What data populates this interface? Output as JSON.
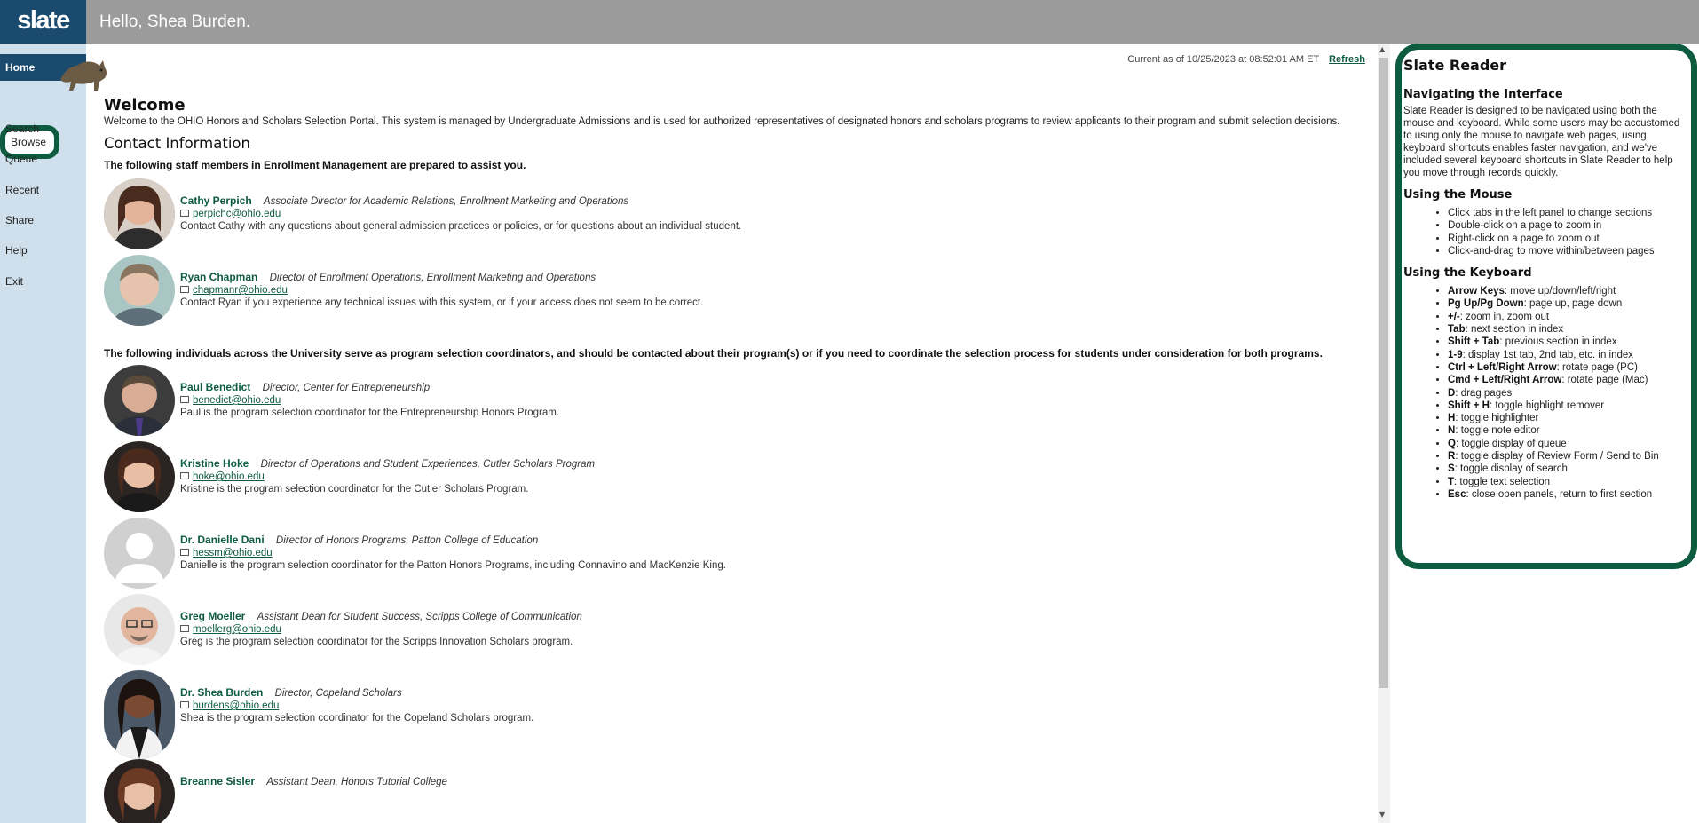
{
  "header": {
    "logo": "slate",
    "greeting": "Hello, Shea Burden."
  },
  "sidebar": {
    "items": [
      "Home",
      "Browse",
      "Search",
      "Queue",
      "Recent",
      "Share",
      "Help",
      "Exit"
    ]
  },
  "main": {
    "timestamp": "Current as of 10/25/2023 at 08:52:01 AM ET",
    "refresh": "Refresh",
    "welcome_title": "Welcome",
    "welcome_text": "Welcome to the OHIO Honors and Scholars Selection Portal. This system is managed by Undergraduate Admissions and is used for authorized representatives of designated honors and scholars programs to review applicants to their program and submit selection decisions.",
    "contact_title": "Contact Information",
    "staff_lead": "The following staff members in Enrollment Management are prepared to assist you.",
    "coord_lead": "The following individuals across the University serve as program selection coordinators, and should be contacted about their program(s) or if you need to coordinate the selection process for students under consideration for both programs.",
    "staff": [
      {
        "name": "Cathy Perpich",
        "title": "Associate Director for Academic Relations, Enrollment Marketing and Operations",
        "email": "perpichc@ohio.edu",
        "note": "Contact Cathy with any questions about general admission practices or policies, or for questions about an individual student."
      },
      {
        "name": "Ryan Chapman",
        "title": "Director of Enrollment Operations, Enrollment Marketing and Operations",
        "email": "chapmanr@ohio.edu",
        "note": "Contact Ryan if you experience any technical issues with this system, or if your access does not seem to be correct."
      }
    ],
    "coordinators": [
      {
        "name": "Paul Benedict",
        "title": "Director, Center for Entrepreneurship",
        "email": "benedict@ohio.edu",
        "note": "Paul is the program selection coordinator for the Entrepreneurship Honors Program."
      },
      {
        "name": "Kristine Hoke",
        "title": "Director of Operations and Student Experiences, Cutler Scholars Program",
        "email": "hoke@ohio.edu",
        "note": "Kristine is the program selection coordinator for the Cutler Scholars Program."
      },
      {
        "name": "Dr. Danielle Dani",
        "title": "Director of Honors Programs, Patton College of Education",
        "email": "hessm@ohio.edu",
        "note": "Danielle is the program selection coordinator for the Patton Honors Programs, including Connavino and MacKenzie King."
      },
      {
        "name": "Greg Moeller",
        "title": "Assistant Dean for Student Success, Scripps College of Communication",
        "email": "moellerg@ohio.edu",
        "note": "Greg is the program selection coordinator for the Scripps Innovation Scholars program."
      },
      {
        "name": "Dr. Shea Burden",
        "title": "Director, Copeland Scholars",
        "email": "burdens@ohio.edu",
        "note": "Shea is the program selection coordinator for the Copeland Scholars program."
      },
      {
        "name": "Breanne Sisler",
        "title": "Assistant Dean, Honors Tutorial College",
        "email": "",
        "note": ""
      }
    ]
  },
  "reader": {
    "title": "Slate Reader",
    "nav_title": "Navigating the Interface",
    "nav_text": "Slate Reader is designed to be navigated using both the mouse and keyboard. While some users may be accustomed to using only the mouse to navigate web pages, using keyboard shortcuts enables faster navigation, and we've included several keyboard shortcuts in Slate Reader to help you move through records quickly.",
    "mouse_title": "Using the Mouse",
    "mouse_items": [
      "Click tabs in the left panel to change sections",
      "Double-click on a page to zoom in",
      "Right-click on a page to zoom out",
      "Click-and-drag to move within/between pages"
    ],
    "keyboard_title": "Using the Keyboard",
    "keyboard_items": [
      {
        "key": "Arrow Keys",
        "desc": ": move up/down/left/right"
      },
      {
        "key": "Pg Up/Pg Down",
        "desc": ": page up, page down"
      },
      {
        "key": "+/-",
        "desc": ": zoom in, zoom out"
      },
      {
        "key": "Tab",
        "desc": ": next section in index"
      },
      {
        "key": "Shift + Tab",
        "desc": ": previous section in index"
      },
      {
        "key": "1-9",
        "desc": ": display 1st tab, 2nd tab, etc. in index"
      },
      {
        "key": "Ctrl + Left/Right Arrow",
        "desc": ": rotate page (PC)"
      },
      {
        "key": "Cmd + Left/Right Arrow",
        "desc": ": rotate page (Mac)"
      },
      {
        "key": "D",
        "desc": ": drag pages"
      },
      {
        "key": "Shift + H",
        "desc": ": toggle highlight remover"
      },
      {
        "key": "H",
        "desc": ": toggle highlighter"
      },
      {
        "key": "N",
        "desc": ": toggle note editor"
      },
      {
        "key": "Q",
        "desc": ": toggle display of queue"
      },
      {
        "key": "R",
        "desc": ": toggle display of Review Form / Send to Bin"
      },
      {
        "key": "S",
        "desc": ": toggle display of search"
      },
      {
        "key": "T",
        "desc": ": toggle text selection"
      },
      {
        "key": "Esc",
        "desc": ": close open panels, return to first section"
      }
    ]
  }
}
